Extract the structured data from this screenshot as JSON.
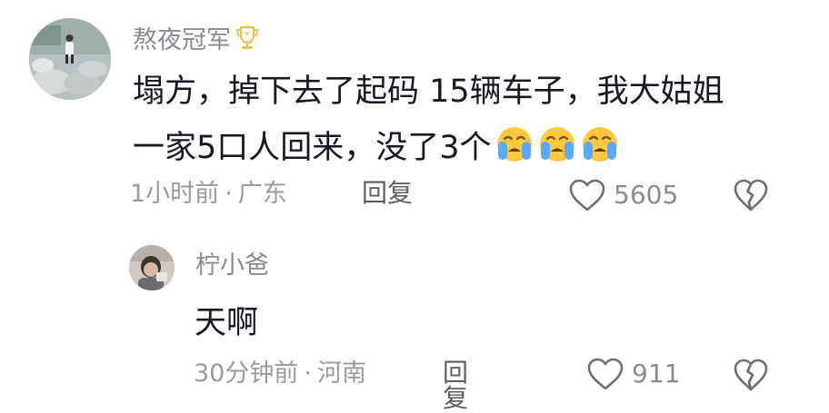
{
  "comments": [
    {
      "username": "熬夜冠军",
      "badge": "trophy-icon",
      "text_lines": [
        "塌方，掉下去了起码 15辆车子，我大姑姐",
        "一家5口人回来，没了3个"
      ],
      "emoji": [
        "loudly-crying-face",
        "loudly-crying-face",
        "loudly-crying-face"
      ],
      "time": "1小时前",
      "separator": "·",
      "location": "广东",
      "reply_label": "回复",
      "likes": "5605"
    },
    {
      "username": "柠小爸",
      "text_lines": [
        "天啊"
      ],
      "time": "30分钟前",
      "separator": "·",
      "location": "河南",
      "reply_label": "回复",
      "likes": "911"
    }
  ],
  "colors": {
    "text_primary": "#161823",
    "text_secondary": "#8a8b91",
    "emoji_face": "#ffc83d",
    "emoji_tear": "#5aa8ff",
    "trophy": "#f0c24b"
  }
}
